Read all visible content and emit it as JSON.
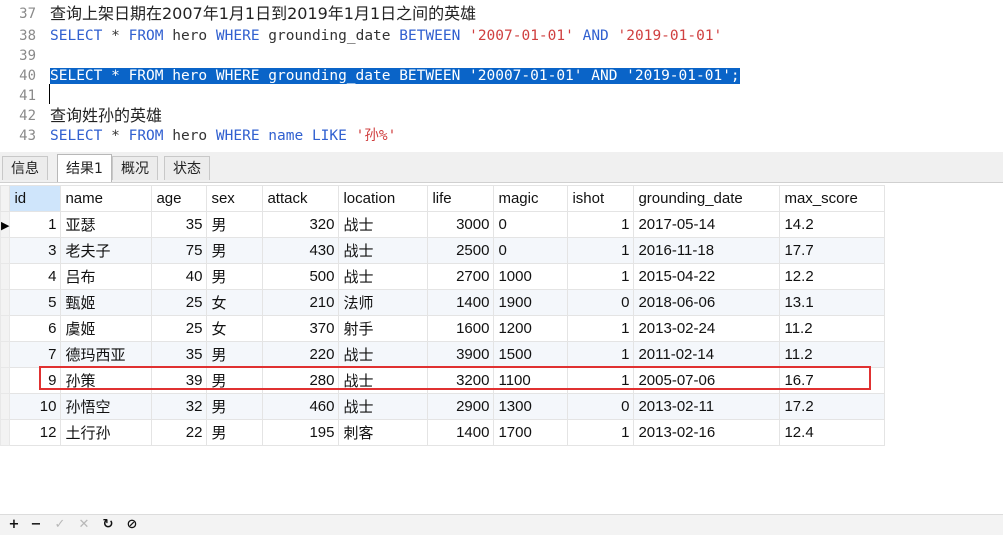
{
  "editor": {
    "lines": [
      {
        "num": "37",
        "parts": [
          {
            "t": "查询上架日期在2007年1月1日到2019年1月1日之间的英雄",
            "c": "comment"
          }
        ]
      },
      {
        "num": "38",
        "parts": [
          {
            "t": "SELECT",
            "c": "kw"
          },
          {
            "t": " * ",
            "c": ""
          },
          {
            "t": "FROM",
            "c": "kw"
          },
          {
            "t": " hero ",
            "c": ""
          },
          {
            "t": "WHERE",
            "c": "kw"
          },
          {
            "t": " grounding_date ",
            "c": ""
          },
          {
            "t": "BETWEEN",
            "c": "kw"
          },
          {
            "t": " ",
            "c": ""
          },
          {
            "t": "'2007-01-01'",
            "c": "str"
          },
          {
            "t": " ",
            "c": ""
          },
          {
            "t": "AND",
            "c": "kw"
          },
          {
            "t": " ",
            "c": ""
          },
          {
            "t": "'2019-01-01'",
            "c": "str"
          }
        ]
      },
      {
        "num": "39",
        "parts": []
      },
      {
        "num": "40",
        "parts": [
          {
            "t": "SELECT * FROM hero WHERE grounding_date BETWEEN '20007-01-01' AND '2019-01-01';",
            "c": "sel"
          }
        ]
      },
      {
        "num": "41",
        "parts": []
      },
      {
        "num": "42",
        "parts": [
          {
            "t": "查询姓孙的英雄",
            "c": "comment"
          }
        ]
      },
      {
        "num": "43",
        "parts": [
          {
            "t": "SELECT",
            "c": "kw"
          },
          {
            "t": " * ",
            "c": ""
          },
          {
            "t": "FROM",
            "c": "kw"
          },
          {
            "t": " hero ",
            "c": ""
          },
          {
            "t": "WHERE",
            "c": "kw"
          },
          {
            "t": " ",
            "c": ""
          },
          {
            "t": "name",
            "c": "kw"
          },
          {
            "t": " ",
            "c": ""
          },
          {
            "t": "LIKE",
            "c": "kw"
          },
          {
            "t": " ",
            "c": ""
          },
          {
            "t": "'孙%'",
            "c": "str"
          }
        ]
      }
    ]
  },
  "tabs": [
    {
      "label": "信息",
      "active": false
    },
    {
      "label": "结果1",
      "active": true
    },
    {
      "label": "概况",
      "active": false
    },
    {
      "label": "状态",
      "active": false
    }
  ],
  "grid": {
    "columns": [
      "id",
      "name",
      "age",
      "sex",
      "attack",
      "location",
      "life",
      "magic",
      "ishot",
      "grounding_date",
      "max_score"
    ],
    "numeric": [
      true,
      false,
      true,
      false,
      true,
      false,
      true,
      false,
      true,
      false,
      false
    ],
    "rows": [
      [
        "1",
        "亚瑟",
        "35",
        "男",
        "320",
        "战士",
        "3000",
        "0",
        "1",
        "2017-05-14",
        "14.2"
      ],
      [
        "3",
        "老夫子",
        "75",
        "男",
        "430",
        "战士",
        "2500",
        "0",
        "1",
        "2016-11-18",
        "17.7"
      ],
      [
        "4",
        "吕布",
        "40",
        "男",
        "500",
        "战士",
        "2700",
        "1000",
        "1",
        "2015-04-22",
        "12.2"
      ],
      [
        "5",
        "甄姬",
        "25",
        "女",
        "210",
        "法师",
        "1400",
        "1900",
        "0",
        "2018-06-06",
        "13.1"
      ],
      [
        "6",
        "虞姬",
        "25",
        "女",
        "370",
        "射手",
        "1600",
        "1200",
        "1",
        "2013-02-24",
        "11.2"
      ],
      [
        "7",
        "德玛西亚",
        "35",
        "男",
        "220",
        "战士",
        "3900",
        "1500",
        "1",
        "2011-02-14",
        "11.2"
      ],
      [
        "9",
        "孙策",
        "39",
        "男",
        "280",
        "战士",
        "3200",
        "1100",
        "1",
        "2005-07-06",
        "16.7"
      ],
      [
        "10",
        "孙悟空",
        "32",
        "男",
        "460",
        "战士",
        "2900",
        "1300",
        "0",
        "2013-02-11",
        "17.2"
      ],
      [
        "12",
        "土行孙",
        "22",
        "男",
        "195",
        "刺客",
        "1400",
        "1700",
        "1",
        "2013-02-16",
        "12.4"
      ]
    ],
    "current_row_marker": "▶",
    "highlighted_row": 6
  },
  "bottombar": [
    {
      "name": "add-record-icon",
      "glyph": "+",
      "enabled": true
    },
    {
      "name": "delete-record-icon",
      "glyph": "−",
      "enabled": true
    },
    {
      "name": "apply-changes-icon",
      "glyph": "✓",
      "enabled": false
    },
    {
      "name": "discard-changes-icon",
      "glyph": "✕",
      "enabled": false
    },
    {
      "name": "refresh-icon",
      "glyph": "↻",
      "enabled": true
    },
    {
      "name": "stop-icon",
      "glyph": "⊘",
      "enabled": true
    }
  ]
}
